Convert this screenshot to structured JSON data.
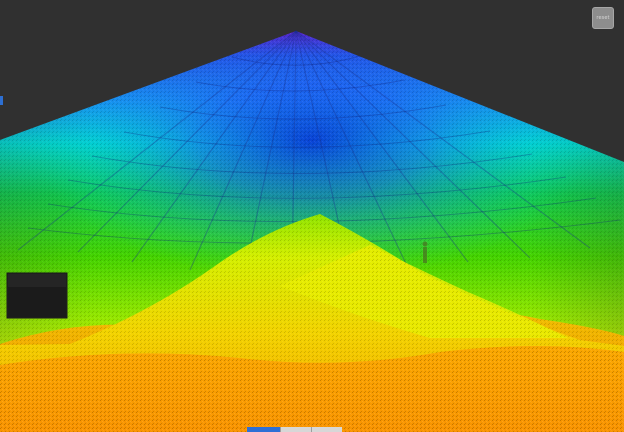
{
  "viewer": {
    "background_color": "#303030",
    "colormap": [
      "#ff7a00",
      "#ffb800",
      "#f7f000",
      "#b7ef00",
      "#44d300",
      "#10c94d",
      "#00d8d0",
      "#1a87f5",
      "#2b3ae8",
      "#6a00c8"
    ]
  },
  "top_right_button": {
    "label": "reset",
    "icon": "view-reset-icon"
  },
  "bottom_toolbar": {
    "buttons": [
      {
        "name": "toolbar-button-1",
        "active": true
      },
      {
        "name": "toolbar-button-2",
        "active": false
      },
      {
        "name": "toolbar-button-3",
        "active": false
      }
    ]
  }
}
